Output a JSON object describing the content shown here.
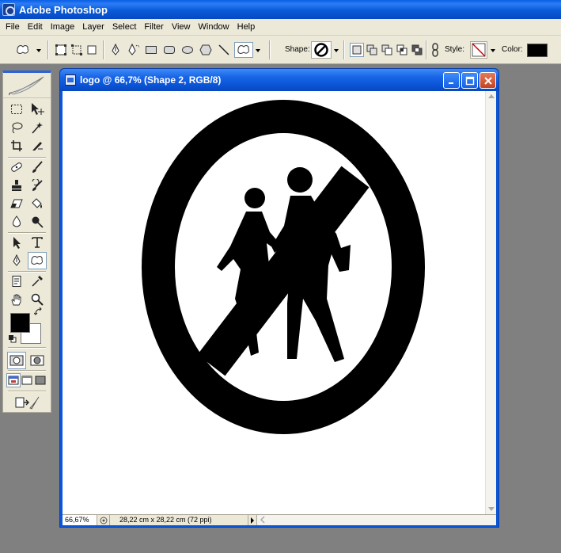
{
  "app": {
    "title": "Adobe Photoshop"
  },
  "menu": [
    "File",
    "Edit",
    "Image",
    "Layer",
    "Select",
    "Filter",
    "View",
    "Window",
    "Help"
  ],
  "options": {
    "shape_label": "Shape:",
    "style_label": "Style:",
    "color_label": "Color:",
    "color_value": "#000000"
  },
  "tools": {
    "foreground_color": "#000000",
    "background_color": "#ffffff",
    "active_tool": "custom-shape"
  },
  "document": {
    "title": "logo @ 66,7% (Shape 2, RGB/8)",
    "zoom": "66,67%",
    "doc_info": "28,22 cm x 28,22 cm (72 ppi)"
  }
}
